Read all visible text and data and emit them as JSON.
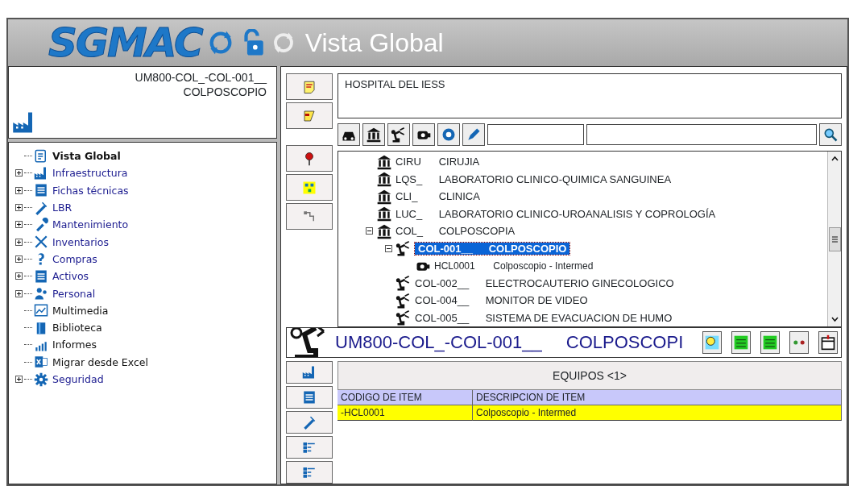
{
  "header": {
    "logo": "SGMAC",
    "title": "Vista Global"
  },
  "selection_box": {
    "code": "UM800-COL_-COL-001__",
    "name": "COLPOSCOPIO"
  },
  "nav_tree": [
    {
      "label": "Vista Global",
      "expandable": false,
      "selected": true,
      "kind": "overview"
    },
    {
      "label": "Infraestructura",
      "expandable": true,
      "selected": false,
      "kind": "factory"
    },
    {
      "label": "Fichas técnicas",
      "expandable": true,
      "selected": false,
      "kind": "sheet"
    },
    {
      "label": "LBR",
      "expandable": true,
      "selected": false,
      "kind": "pen"
    },
    {
      "label": "Mantenimiento",
      "expandable": true,
      "selected": false,
      "kind": "wrench"
    },
    {
      "label": "Inventarios",
      "expandable": true,
      "selected": false,
      "kind": "tools"
    },
    {
      "label": "Compras",
      "expandable": true,
      "selected": false,
      "kind": "question"
    },
    {
      "label": "Activos",
      "expandable": true,
      "selected": false,
      "kind": "sheet"
    },
    {
      "label": "Personal",
      "expandable": true,
      "selected": false,
      "kind": "people"
    },
    {
      "label": "Multimedia",
      "expandable": false,
      "selected": false,
      "kind": "chart"
    },
    {
      "label": "Biblioteca",
      "expandable": false,
      "selected": false,
      "kind": "book"
    },
    {
      "label": "Informes",
      "expandable": false,
      "selected": false,
      "kind": "bars"
    },
    {
      "label": "Migrar desde Excel",
      "expandable": false,
      "selected": false,
      "kind": "excel"
    },
    {
      "label": "Seguridad",
      "expandable": true,
      "selected": false,
      "kind": "gear"
    }
  ],
  "hospital": {
    "label": "HOSPITAL DEL IESS"
  },
  "tree": [
    {
      "code": "CIRU",
      "name": "CIRUJIA",
      "kind": "department",
      "selected": false
    },
    {
      "code": "LQS_",
      "name": "LABORATORIO CLINICO-QUIMICA SANGUINEA",
      "kind": "department",
      "selected": false
    },
    {
      "code": "CLI_",
      "name": "CLINICA",
      "kind": "department",
      "selected": false
    },
    {
      "code": "LUC_",
      "name": "LABORATORIO CLINICO-UROANALISIS Y COPROLOGÍA",
      "kind": "department",
      "selected": false
    },
    {
      "code": "COL_",
      "name": "COLPOSCOPIA",
      "kind": "department",
      "expanded": true,
      "selected": false,
      "children": [
        {
          "code": "COL-001__",
          "name": "COLPOSCOPIO",
          "kind": "equipment",
          "expanded": true,
          "selected": true,
          "children": [
            {
              "code": "HCL0001",
              "name": "Colposcopio - Intermed",
              "kind": "item",
              "selected": false
            }
          ]
        },
        {
          "code": "COL-002__",
          "name": "ELECTROCAUTERIO GINECOLOGICO",
          "kind": "equipment",
          "selected": false
        },
        {
          "code": "COL-004__",
          "name": "MONITOR DE VIDEO",
          "kind": "equipment",
          "selected": false
        },
        {
          "code": "COL-005__",
          "name": "SISTEMA DE EVACUACION DE HUMO",
          "kind": "equipment",
          "selected": false
        }
      ]
    }
  ],
  "detail": {
    "code": "UM800-COL_-COL-001__",
    "name": "COLPOSCOPI"
  },
  "table": {
    "caption": "EQUIPOS <1>",
    "columns": [
      "CODIGO DE ITEM",
      "DESCRIPCION DE ITEM"
    ],
    "rows": [
      {
        "cells": [
          "-HCL0001",
          "Colposcopio - Intermed"
        ],
        "selected": true
      }
    ]
  }
}
